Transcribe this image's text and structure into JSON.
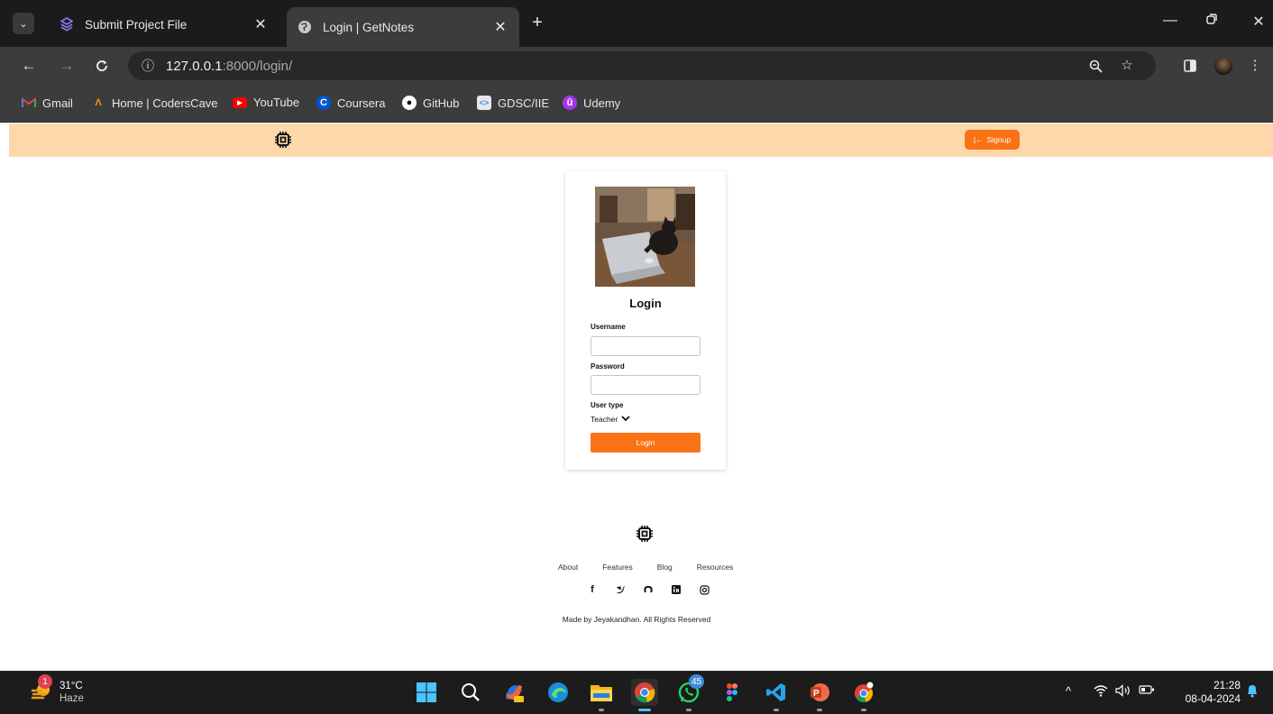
{
  "browser": {
    "tabs": [
      {
        "title": "Submit Project File",
        "active": false
      },
      {
        "title": "Login | GetNotes",
        "active": true
      }
    ],
    "url_host": "127.0.0.1",
    "url_rest": ":8000/login/",
    "bookmarks": [
      {
        "label": "Gmail",
        "icon": "gmail-icon"
      },
      {
        "label": "Home | CodersCave",
        "icon": "coderscave-icon"
      },
      {
        "label": "YouTube",
        "icon": "youtube-icon"
      },
      {
        "label": "Coursera",
        "icon": "coursera-icon"
      },
      {
        "label": "GitHub",
        "icon": "github-icon"
      },
      {
        "label": "GDSC/IIE",
        "icon": "gdsc-icon"
      },
      {
        "label": "Udemy",
        "icon": "udemy-icon"
      }
    ]
  },
  "header": {
    "signup_label": "Signup",
    "signup_icon": "|←"
  },
  "login": {
    "title": "Login",
    "username_label": "Username",
    "username_value": "",
    "password_label": "Password",
    "password_value": "",
    "usertype_label": "User type",
    "usertype_value": "Teacher",
    "submit_label": "Login"
  },
  "footer": {
    "links": [
      "About",
      "Features",
      "Blog",
      "Resources"
    ],
    "social": [
      "facebook-icon",
      "twitter-icon",
      "github-icon",
      "linkedin-icon",
      "instagram-icon"
    ],
    "copyright": "Made by Jeyakandhan. All Rights Reserved"
  },
  "taskbar": {
    "temperature": "31°C",
    "weather": "Haze",
    "weather_badge": "1",
    "whatsapp_badge": "45",
    "time": "21:28",
    "date": "08-04-2024"
  },
  "colors": {
    "accent": "#f97316",
    "header_bg": "#fed7aa"
  }
}
